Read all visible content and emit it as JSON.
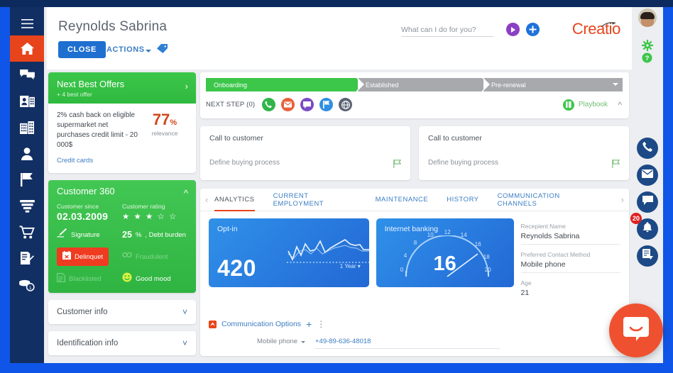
{
  "app": {
    "brand": "Creatio"
  },
  "nav_rail": {
    "items": [
      {
        "name": "menu",
        "icon": "hamburger-icon"
      },
      {
        "name": "home",
        "icon": "home-icon",
        "active": true
      },
      {
        "name": "feed",
        "icon": "chat-bubbles-icon"
      },
      {
        "name": "contacts",
        "icon": "contact-card-icon"
      },
      {
        "name": "accounts",
        "icon": "building-icon"
      },
      {
        "name": "leads",
        "icon": "person-icon"
      },
      {
        "name": "campaigns",
        "icon": "flag-icon"
      },
      {
        "name": "opportunities",
        "icon": "funnel-icon"
      },
      {
        "name": "orders",
        "icon": "cart-icon"
      },
      {
        "name": "contracts",
        "icon": "document-edit-icon"
      },
      {
        "name": "invoices",
        "icon": "coins-icon"
      }
    ]
  },
  "header": {
    "title": "Reynolds Sabrina",
    "close_label": "CLOSE",
    "actions_label": "ACTIONS",
    "tag_icon": "tag-icon"
  },
  "search": {
    "placeholder": "What can I do for you?",
    "play_icon": "play-icon",
    "add_icon": "plus-icon"
  },
  "util_rail": {
    "avatar": "user-avatar",
    "gear_icon": "gear-icon",
    "help_icon": "help-icon",
    "buttons": [
      {
        "name": "call",
        "icon": "phone-icon"
      },
      {
        "name": "email",
        "icon": "envelope-icon"
      },
      {
        "name": "chat",
        "icon": "message-icon"
      },
      {
        "name": "notifications",
        "icon": "bell-icon",
        "badge": "20"
      },
      {
        "name": "tasks",
        "icon": "task-icon"
      }
    ]
  },
  "next_best_offers": {
    "title": "Next Best Offers",
    "subtitle": "+ 4 best offer",
    "offer_text": "2% cash back on eligible supermarket net purchases credit limit - 20 000$",
    "link": "Credit cards",
    "relevance_value": "77",
    "relevance_pct": "%",
    "relevance_label": "relevance"
  },
  "customer360": {
    "title": "Customer 360",
    "since_label": "Customer since",
    "since_value": "02.03.2009",
    "rating_label": "Customer rating",
    "rating_stars": "★ ★ ★ ☆ ☆",
    "rating_filled": 3,
    "signature_label": "Signature",
    "debt_value": "25",
    "debt_unit": "%",
    "debt_label": ", Debt burden",
    "delinquent_label": "Delinquet",
    "fraudulent_label": "Fraudulent",
    "blacklisted_label": "Blacklisted",
    "mood_label": "Good mood"
  },
  "accordions": [
    {
      "label": "Customer info"
    },
    {
      "label": "Identification info"
    }
  ],
  "process": {
    "stages": [
      {
        "label": "Onboarding",
        "state": "done"
      },
      {
        "label": "Established",
        "state": "todo"
      },
      {
        "label": "Pre-renewal",
        "state": "todo"
      }
    ],
    "next_step_label": "NEXT STEP (0)",
    "action_icons": [
      {
        "name": "call-action",
        "icon": "phone-icon"
      },
      {
        "name": "email-action",
        "icon": "envelope-icon"
      },
      {
        "name": "message-action",
        "icon": "message-icon"
      },
      {
        "name": "flag-action",
        "icon": "flag-icon"
      },
      {
        "name": "web-action",
        "icon": "globe-icon"
      }
    ],
    "playbook_label": "Playbook"
  },
  "tasks": [
    {
      "title": "Call to customer",
      "subtitle": "Define buying process"
    },
    {
      "title": "Call to customer",
      "subtitle": "Define buying process"
    }
  ],
  "tabs": [
    {
      "label": "ANALYTICS",
      "active": true
    },
    {
      "label": "CURRENT EMPLOYMENT",
      "active": false
    },
    {
      "label": "MAINTENANCE",
      "active": false
    },
    {
      "label": "HISTORY",
      "active": false
    },
    {
      "label": "COMMUNICATION CHANNELS",
      "active": false
    }
  ],
  "widgets": {
    "optin": {
      "title": "Opt-in",
      "value": "420",
      "period": "1 Year"
    },
    "banking": {
      "title": "Internet banking",
      "value": "16",
      "ticks": [
        "0",
        "4",
        "8",
        "10",
        "12",
        "14",
        "16",
        "18",
        "20"
      ],
      "min": 0,
      "max": 20
    }
  },
  "info_fields": [
    {
      "label": "Recepient Name",
      "value": "Reynolds Sabrina"
    },
    {
      "label": "Preferred Contact Method",
      "value": "Mobile phone"
    },
    {
      "label": "Age",
      "value": "21"
    }
  ],
  "communication": {
    "section_label": "Communication Options",
    "add_icon": "plus-icon",
    "menu_icon": "kebab-menu-icon",
    "type_label": "Mobile phone",
    "value": "+49-89-636-48018"
  },
  "chat_widget": {
    "icon": "chat-bubble-icon"
  },
  "colors": {
    "accent_orange": "#e8441b",
    "brand_blue": "#1f6fd0",
    "green": "#3cc64a",
    "nav_dark": "#122f63",
    "desktop_blue": "#0f56e8"
  }
}
